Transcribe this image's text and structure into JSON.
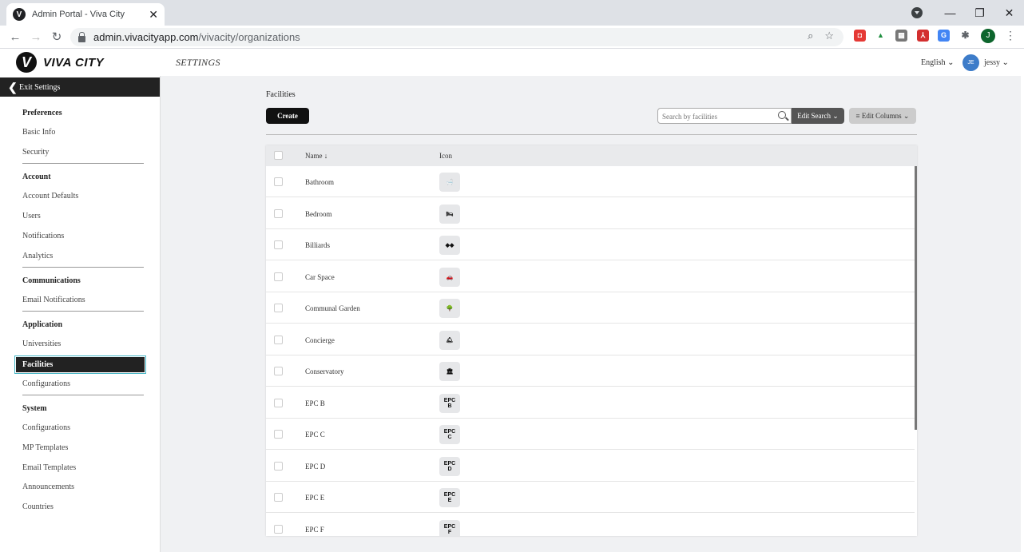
{
  "browser": {
    "tab_title": "Admin Portal - Viva City",
    "favicon_letter": "V",
    "url_host": "admin.vivacityapp.com",
    "url_path": "/vivacity/organizations",
    "profile_initial": "J"
  },
  "header": {
    "logo_letter": "V",
    "logo_text": "VIVA CITY",
    "section_title": "SETTINGS",
    "language": "English",
    "avatar_initials": "JE",
    "username": "jessy"
  },
  "sidebar": {
    "exit_label": "Exit Settings",
    "groups": [
      {
        "title": "Preferences",
        "items": [
          "Basic Info",
          "Security"
        ]
      },
      {
        "title": "Account",
        "items": [
          "Account Defaults",
          "Users",
          "Notifications",
          "Analytics"
        ]
      },
      {
        "title": "Communications",
        "items": [
          "Email Notifications"
        ]
      },
      {
        "title": "Application",
        "items": [
          "Universities",
          "Facilities",
          "Configurations"
        ]
      },
      {
        "title": "System",
        "items": [
          "Configurations",
          "MP Templates",
          "Email Templates",
          "Announcements",
          "Countries"
        ]
      }
    ],
    "active_item": "Facilities"
  },
  "main": {
    "page_title": "Facilities",
    "create_label": "Create",
    "search_placeholder": "Search by facilities",
    "edit_search_label": "Edit Search",
    "edit_columns_label": "Edit Columns",
    "columns": {
      "name": "Name",
      "icon": "Icon"
    },
    "rows": [
      {
        "name": "Bathroom",
        "icon": "bathtub-icon",
        "glyph": "🛁"
      },
      {
        "name": "Bedroom",
        "icon": "bed-icon",
        "glyph": "🛏"
      },
      {
        "name": "Billiards",
        "icon": "billiards-icon",
        "glyph": "◆◆"
      },
      {
        "name": "Car Space",
        "icon": "car-icon",
        "glyph": "🚗"
      },
      {
        "name": "Communal Garden",
        "icon": "garden-icon",
        "glyph": "🌳"
      },
      {
        "name": "Concierge",
        "icon": "concierge-bell-icon",
        "glyph": "🛎"
      },
      {
        "name": "Conservatory",
        "icon": "conservatory-icon",
        "glyph": "🏛"
      },
      {
        "name": "EPC B",
        "icon": "epc-b-icon",
        "glyph_top": "EPC",
        "glyph_bottom": "B"
      },
      {
        "name": "EPC C",
        "icon": "epc-c-icon",
        "glyph_top": "EPC",
        "glyph_bottom": "C"
      },
      {
        "name": "EPC D",
        "icon": "epc-d-icon",
        "glyph_top": "EPC",
        "glyph_bottom": "D"
      },
      {
        "name": "EPC E",
        "icon": "epc-e-icon",
        "glyph_top": "EPC",
        "glyph_bottom": "E"
      },
      {
        "name": "EPC F",
        "icon": "epc-f-icon",
        "glyph_top": "EPC",
        "glyph_bottom": "F"
      }
    ]
  }
}
